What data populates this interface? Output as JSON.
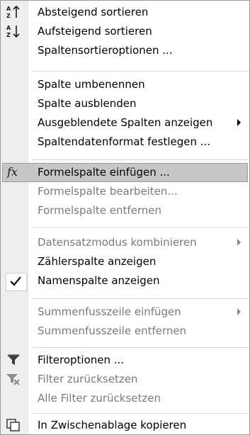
{
  "menu": {
    "items": [
      {
        "label": "Absteigend sortieren",
        "icon": "sort-descending-icon",
        "enabled": true
      },
      {
        "label": "Aufsteigend sortieren",
        "icon": "sort-ascending-icon",
        "enabled": true
      },
      {
        "label": "Spaltensortieroptionen ...",
        "enabled": true
      },
      {
        "label": "Spalte umbenennen",
        "enabled": true
      },
      {
        "label": "Spalte ausblenden",
        "enabled": true
      },
      {
        "label": "Ausgeblendete Spalten anzeigen",
        "enabled": true,
        "submenu": true
      },
      {
        "label": "Spaltendatenformat festlegen ...",
        "enabled": true
      },
      {
        "label": "Formelspalte einfügen ...",
        "icon": "fx-icon",
        "enabled": true,
        "highlighted": true
      },
      {
        "label": "Formelspalte bearbeiten...",
        "enabled": false
      },
      {
        "label": "Formelspalte entfernen",
        "enabled": false
      },
      {
        "label": "Datensatzmodus kombinieren",
        "enabled": false,
        "submenu": true
      },
      {
        "label": "Zählerspalte anzeigen",
        "enabled": true
      },
      {
        "label": "Namenspalte anzeigen",
        "icon": "checkmark-icon",
        "enabled": true,
        "checked": true
      },
      {
        "label": "Summenfusszeile einfügen",
        "enabled": false,
        "submenu": true
      },
      {
        "label": "Summenfusszeile entfernen",
        "enabled": false
      },
      {
        "label": "Filteroptionen ...",
        "icon": "funnel-icon",
        "enabled": true
      },
      {
        "label": "Filter zurücksetzen",
        "icon": "clear-filter-icon",
        "enabled": false
      },
      {
        "label": "Alle Filter zurücksetzen",
        "enabled": false
      },
      {
        "label": "In Zwischenablage kopieren",
        "icon": "copy-icon",
        "enabled": true
      }
    ],
    "fx_symbol": "fx",
    "colors": {
      "highlight": "#c7c7c7",
      "gutter": "#eeeeee",
      "disabled_text": "#7a7a7a",
      "separator": "#d9d9d9"
    }
  }
}
